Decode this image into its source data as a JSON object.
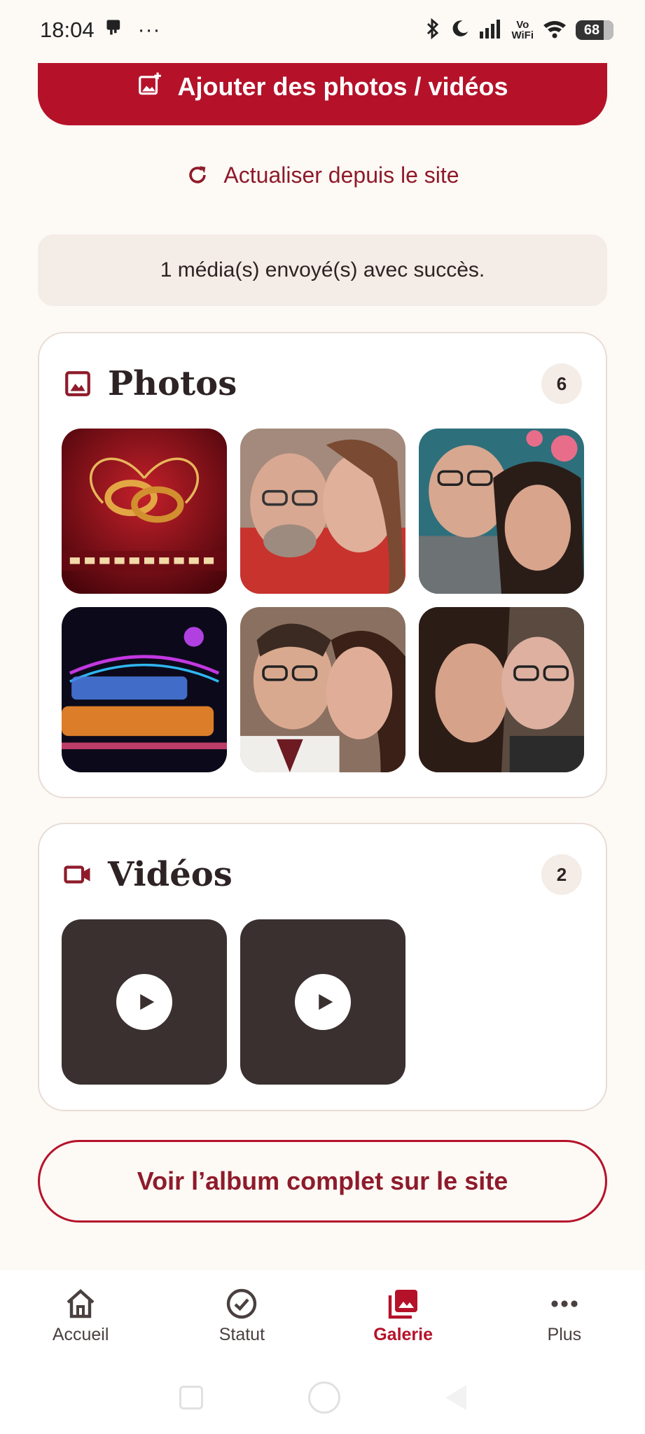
{
  "status_bar": {
    "time": "18:04",
    "more": "···",
    "vowifi_top": "Vo",
    "vowifi_bottom": "WiFi",
    "battery": "68"
  },
  "actions": {
    "add_media_label": "Ajouter des photos / vidéos",
    "refresh_label": "Actualiser depuis le site",
    "view_album_label": "Voir l’album complet sur le site"
  },
  "toast": {
    "message": "1 média(s) envoyé(s) avec succès."
  },
  "photos": {
    "title": "Photos",
    "count": "6"
  },
  "videos": {
    "title": "Vidéos",
    "count": "2"
  },
  "bottom_nav": {
    "items": [
      {
        "label": "Accueil",
        "icon": "home-icon"
      },
      {
        "label": "Statut",
        "icon": "check-circle-icon"
      },
      {
        "label": "Galerie",
        "icon": "gallery-icon",
        "active": true
      },
      {
        "label": "Plus",
        "icon": "more-icon"
      }
    ]
  },
  "colors": {
    "brand": "#b5122a",
    "brand_dark": "#8e1b2b",
    "background": "#fdf9f5",
    "video_tile": "#3a3030"
  }
}
